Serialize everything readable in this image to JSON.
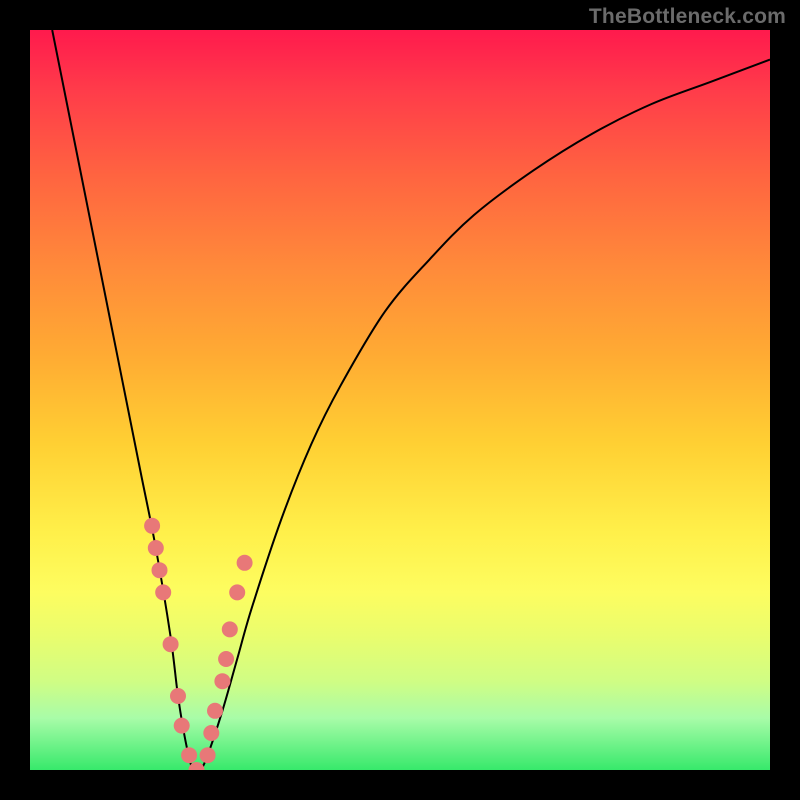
{
  "watermark": "TheBottleneck.com",
  "colors": {
    "frame": "#000000",
    "curve": "#000000",
    "dot": "#e87878",
    "gradient_top": "#ff1a4d",
    "gradient_bottom": "#37e96b"
  },
  "chart_data": {
    "type": "line",
    "title": "",
    "xlabel": "",
    "ylabel": "",
    "xlim": [
      0,
      100
    ],
    "ylim": [
      0,
      100
    ],
    "series": [
      {
        "name": "bottleneck-curve",
        "x": [
          3,
          5,
          7,
          9,
          11,
          13,
          15,
          17,
          19,
          20,
          21,
          22,
          23,
          24,
          26,
          28,
          30,
          34,
          38,
          42,
          48,
          54,
          60,
          68,
          76,
          84,
          92,
          100
        ],
        "values": [
          100,
          90,
          80,
          70,
          60,
          50,
          40,
          30,
          18,
          10,
          4,
          0,
          0,
          2,
          8,
          15,
          22,
          34,
          44,
          52,
          62,
          69,
          75,
          81,
          86,
          90,
          93,
          96
        ]
      }
    ],
    "markers": {
      "name": "highlight-dots",
      "x": [
        16.5,
        17,
        17.5,
        18,
        19,
        20,
        20.5,
        21.5,
        22.5,
        24,
        24.5,
        25,
        26,
        26.5,
        27,
        28,
        29
      ],
      "values": [
        33,
        30,
        27,
        24,
        17,
        10,
        6,
        2,
        0,
        2,
        5,
        8,
        12,
        15,
        19,
        24,
        28
      ]
    }
  }
}
